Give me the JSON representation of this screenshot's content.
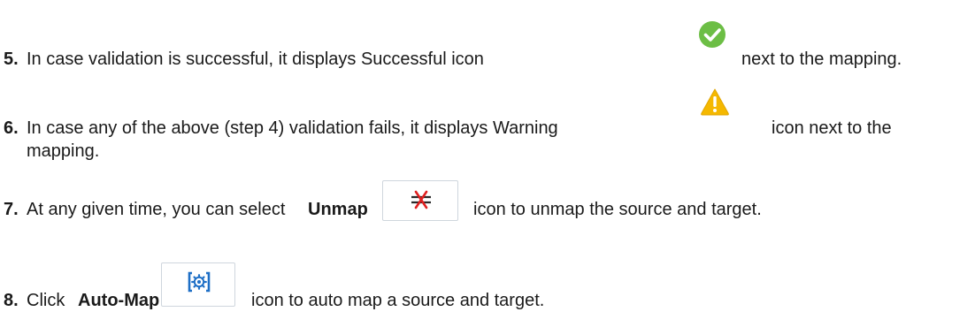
{
  "steps": [
    {
      "number": "5.",
      "text_before": "In case validation is successful, it displays Successful icon",
      "text_after": "next to the mapping.",
      "icon": "success-check-icon",
      "icon_color": "#6cbe45"
    },
    {
      "number": "6.",
      "text_before": "In case any of the above (step 4) validation fails, it displays Warning",
      "text_after": "icon next to the",
      "continuation": "mapping.",
      "icon": "warning-triangle-icon",
      "icon_color": "#f5b800"
    },
    {
      "number": "7.",
      "text_before": "At any given time, you can select",
      "bold": "Unmap",
      "text_after": "icon to unmap the source and target.",
      "icon": "unmap-icon",
      "icon_colors": {
        "strike": "#e02020",
        "lines": "#2a2a2a"
      }
    },
    {
      "number": "8.",
      "text_before": "Click",
      "bold": "Auto-Map",
      "text_after": "icon to auto map a source and target.",
      "icon": "auto-map-icon",
      "icon_color": "#1e6fc6"
    }
  ]
}
